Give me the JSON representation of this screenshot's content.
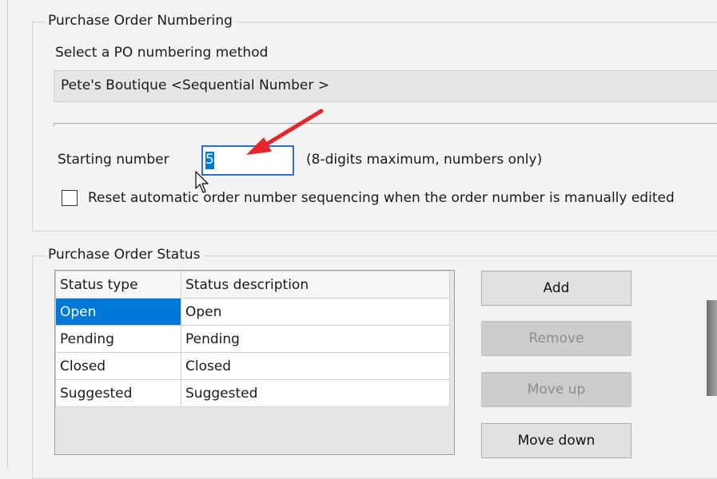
{
  "numbering": {
    "legend": "Purchase Order Numbering",
    "method_label": "Select a PO numbering method",
    "method_selected": "Pete's Boutique <Sequential Number >",
    "starting_label": "Starting number",
    "starting_value": "5",
    "starting_hint": "(8-digits maximum, numbers only)",
    "reset_label": "Reset automatic order number sequencing when the order number is manually edited",
    "reset_checked": false
  },
  "status": {
    "legend": "Purchase Order Status",
    "columns": [
      "Status type",
      "Status description"
    ],
    "rows": [
      {
        "type": "Open",
        "description": "Open",
        "selected": true
      },
      {
        "type": "Pending",
        "description": "Pending",
        "selected": false
      },
      {
        "type": "Closed",
        "description": "Closed",
        "selected": false
      },
      {
        "type": "Suggested",
        "description": "Suggested",
        "selected": false
      }
    ],
    "buttons": {
      "add": "Add",
      "remove": "Remove",
      "move_up": "Move up",
      "move_down": "Move down"
    }
  },
  "colors": {
    "selection": "#0078d7",
    "focus_border": "#2c6fd1",
    "annotation_arrow": "#e8262a"
  }
}
